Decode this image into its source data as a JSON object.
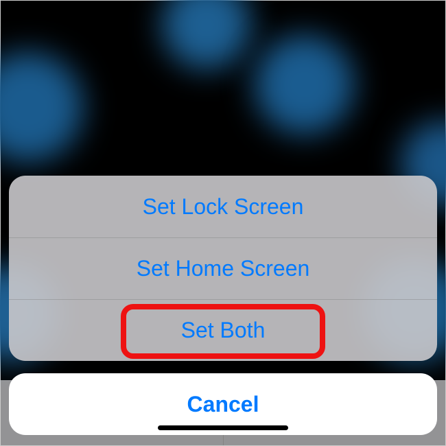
{
  "actionSheet": {
    "options": [
      {
        "label": "Set Lock Screen"
      },
      {
        "label": "Set Home Screen"
      },
      {
        "label": "Set Both"
      }
    ],
    "cancel_label": "Cancel"
  },
  "highlight_color": "#ee1212",
  "link_color": "#007aff"
}
